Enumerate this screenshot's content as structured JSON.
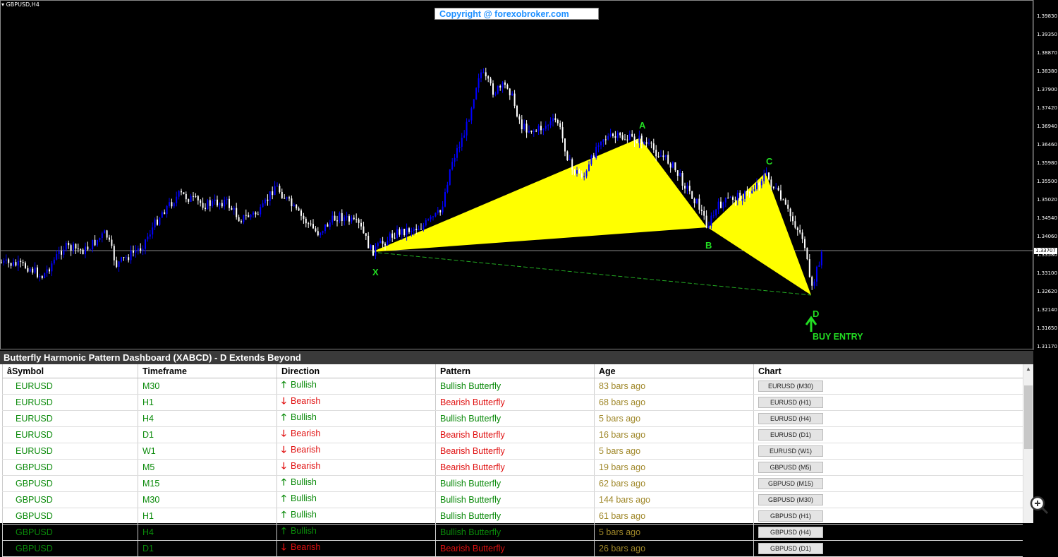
{
  "chart": {
    "symbol_label": "GBPUSD,H4",
    "copyright": "Copyright @ forexobroker.com",
    "points": {
      "x": "X",
      "a": "A",
      "b": "B",
      "c": "C",
      "d": "D"
    },
    "buy_entry": "BUY ENTRY",
    "current_price": "1.33707",
    "price_ticks": [
      "1.39830",
      "1.39350",
      "1.38870",
      "1.38380",
      "1.37900",
      "1.37420",
      "1.36940",
      "1.36460",
      "1.35980",
      "1.35500",
      "1.35020",
      "1.34540",
      "1.34060",
      "1.33580",
      "1.33100",
      "1.32620",
      "1.32140",
      "1.31650",
      "1.31170"
    ],
    "colors": {
      "bull_candle": "#0000ff",
      "bear_candle": "#ffffff",
      "pattern_fill": "#ffff00",
      "label_green": "#22dd22"
    }
  },
  "dashboard": {
    "title": "Butterfly Harmonic Pattern Dashboard (XABCD) - D Extends Beyond",
    "columns": [
      "âSymbol",
      "Timeframe",
      "Direction",
      "Pattern",
      "Age",
      "Chart"
    ],
    "rows": [
      {
        "symbol": "EURUSD",
        "timeframe": "M30",
        "direction": "Bullish",
        "pattern": "Bullish Butterfly",
        "age": "83 bars ago",
        "chart": "EURUSD (M30)"
      },
      {
        "symbol": "EURUSD",
        "timeframe": "H1",
        "direction": "Bearish",
        "pattern": "Bearish Butterfly",
        "age": "68 bars ago",
        "chart": "EURUSD (H1)"
      },
      {
        "symbol": "EURUSD",
        "timeframe": "H4",
        "direction": "Bullish",
        "pattern": "Bullish Butterfly",
        "age": "5 bars ago",
        "chart": "EURUSD (H4)"
      },
      {
        "symbol": "EURUSD",
        "timeframe": "D1",
        "direction": "Bearish",
        "pattern": "Bearish Butterfly",
        "age": "16 bars ago",
        "chart": "EURUSD (D1)"
      },
      {
        "symbol": "EURUSD",
        "timeframe": "W1",
        "direction": "Bearish",
        "pattern": "Bearish Butterfly",
        "age": "5 bars ago",
        "chart": "EURUSD (W1)"
      },
      {
        "symbol": "GBPUSD",
        "timeframe": "M5",
        "direction": "Bearish",
        "pattern": "Bearish Butterfly",
        "age": "19 bars ago",
        "chart": "GBPUSD (M5)"
      },
      {
        "symbol": "GBPUSD",
        "timeframe": "M15",
        "direction": "Bullish",
        "pattern": "Bullish Butterfly",
        "age": "62 bars ago",
        "chart": "GBPUSD (M15)"
      },
      {
        "symbol": "GBPUSD",
        "timeframe": "M30",
        "direction": "Bullish",
        "pattern": "Bullish Butterfly",
        "age": "144 bars ago",
        "chart": "GBPUSD (M30)"
      },
      {
        "symbol": "GBPUSD",
        "timeframe": "H1",
        "direction": "Bullish",
        "pattern": "Bullish Butterfly",
        "age": "61 bars ago",
        "chart": "GBPUSD (H1)"
      },
      {
        "symbol": "GBPUSD",
        "timeframe": "H4",
        "direction": "Bullish",
        "pattern": "Bullish Butterfly",
        "age": "5 bars ago",
        "chart": "GBPUSD (H4)"
      },
      {
        "symbol": "GBPUSD",
        "timeframe": "D1",
        "direction": "Bearish",
        "pattern": "Bearish Butterfly",
        "age": "26 bars ago",
        "chart": "GBPUSD (D1)"
      }
    ],
    "colors": {
      "bullish": "#0a8a0a",
      "bearish": "#e01010",
      "age": "#a0882a"
    }
  }
}
